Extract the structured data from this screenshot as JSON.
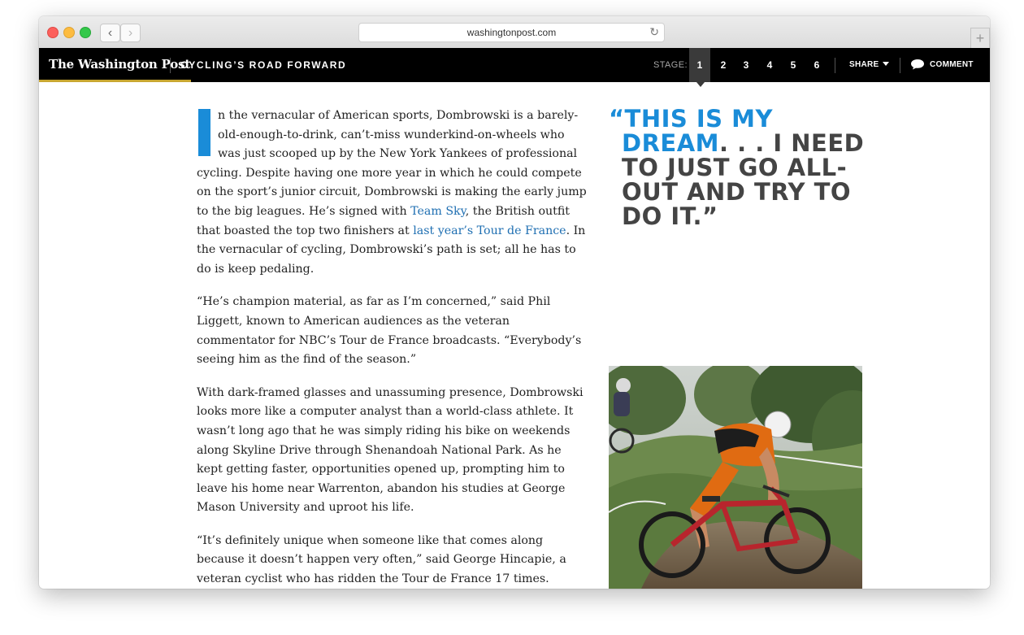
{
  "browser": {
    "url": "washingtonpost.com",
    "back_icon": "‹",
    "forward_icon": "›",
    "reload_icon": "↻",
    "new_tab_icon": "+"
  },
  "site": {
    "logo_text": "The Washington Post",
    "section_title": "CYCLING’S ROAD FORWARD",
    "stage_label": "STAGE:",
    "stages": [
      "1",
      "2",
      "3",
      "4",
      "5",
      "6"
    ],
    "active_stage": "1",
    "share_label": "SHARE",
    "comment_label": "COMMENT"
  },
  "article": {
    "p1_before_link1": "n the vernacular of American sports, Dombrowski is a barely-old-enough-to-drink, can’t-miss wunderkind-on-wheels who was just scooped up by the New York Yankees of professional cycling. Despite having one more year in which he could compete on the sport’s junior circuit, Dombrowski is making the early jump to the big leagues. He’s signed with ",
    "link1": "Team Sky",
    "p1_between_links": ", the British outfit that boasted the top two finishers at ",
    "link2": "last year’s Tour de France",
    "p1_after_link2": ". In the vernacular of cycling, Dombrowski’s path is set; all he has to do is keep pedaling.",
    "p2": "“He’s champion material, as far as I’m concerned,” said Phil Liggett, known to American audiences as the veteran commentator for NBC’s Tour de France broadcasts. “Everybody’s seeing him as the find of the season.”",
    "p3": "With dark-framed glasses and unassuming presence, Dombrowski looks more like a computer analyst than a world-class athlete. It wasn’t long ago that he was simply riding his bike on weekends along Skyline Drive through Shenandoah National Park. As he kept getting faster, opportunities opened up, prompting him to leave his home near Warrenton, abandon his studies at George Mason University and uproot his life.",
    "p4": "“It’s definitely unique when someone like that comes along because it doesn’t happen very often,” said George Hincapie, a veteran cyclist who has ridden the Tour de France 17 times."
  },
  "pullquote": {
    "line1": "“THIS IS MY",
    "line2_blue": "DREAM",
    "line2_rest": ". . . I NEED",
    "line3": "TO JUST GO ALL-",
    "line4": "OUT AND TRY TO",
    "line5": "DO IT.”"
  },
  "colors": {
    "accent_blue": "#1a8cd8",
    "nav_bg": "#000000",
    "mast_underline": "#c8a731"
  }
}
